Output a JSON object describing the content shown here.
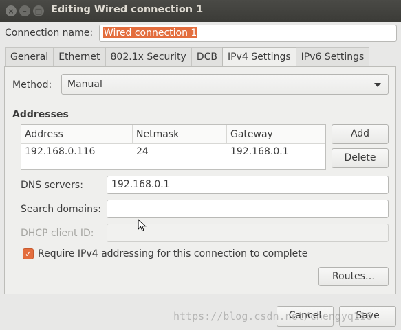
{
  "window": {
    "title": "Editing Wired connection 1",
    "controls": [
      "close-icon",
      "minimize-icon",
      "maximize-icon"
    ]
  },
  "connection": {
    "label": "Connection name:",
    "value": "Wired connection 1"
  },
  "tabs": [
    {
      "label": "General"
    },
    {
      "label": "Ethernet"
    },
    {
      "label": "802.1x Security"
    },
    {
      "label": "DCB"
    },
    {
      "label": "IPv4 Settings",
      "active": true
    },
    {
      "label": "IPv6 Settings"
    }
  ],
  "method": {
    "label": "Method:",
    "value": "Manual"
  },
  "addresses": {
    "heading": "Addresses",
    "columns": [
      "Address",
      "Netmask",
      "Gateway"
    ],
    "rows": [
      [
        "192.168.0.116",
        "24",
        "192.168.0.1"
      ]
    ],
    "add_label": "Add",
    "delete_label": "Delete"
  },
  "dns": {
    "label": "DNS servers:",
    "value": "192.168.0.1"
  },
  "search_domains": {
    "label": "Search domains:",
    "value": ""
  },
  "dhcp_client_id": {
    "label": "DHCP client ID:",
    "value": ""
  },
  "require_ipv4": {
    "checked": true,
    "label": "Require IPv4 addressing for this connection to complete"
  },
  "routes_label": "Routes…",
  "footer": {
    "cancel_label": "Cancel",
    "save_label": "Save"
  },
  "watermark": "https://blog.csdn.net/chengyq116",
  "colors": {
    "accent": "#e36d3d",
    "titlebar": "#3b3b37"
  }
}
